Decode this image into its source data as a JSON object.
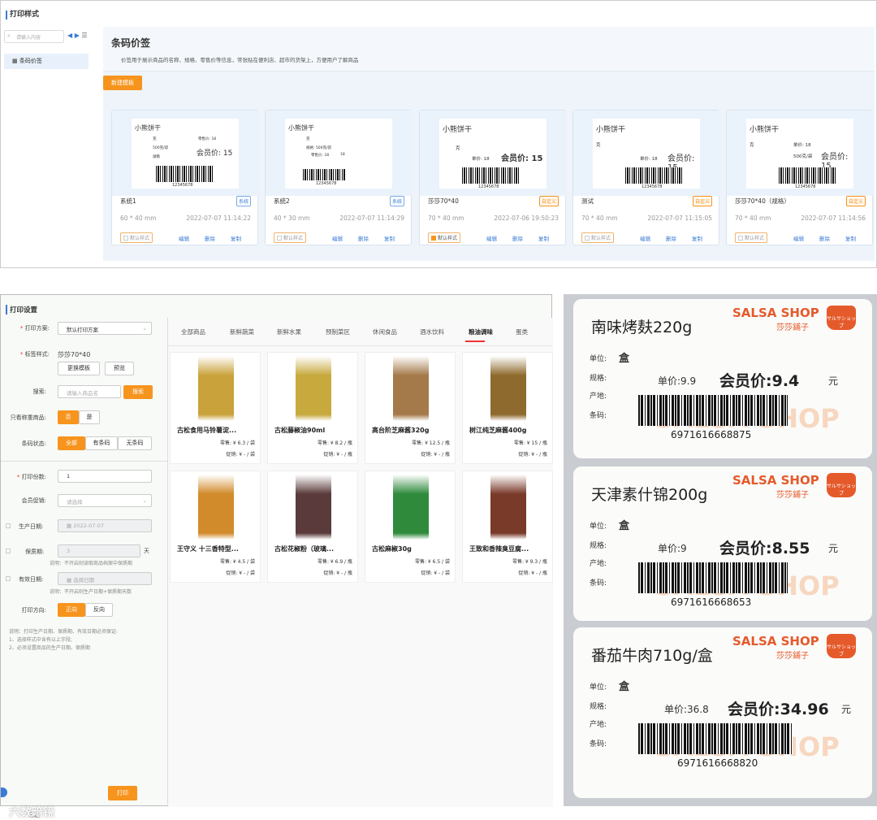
{
  "panel1": {
    "title": "打印样式",
    "search_placeholder": "请输入内容",
    "tree_item": "条码价签",
    "header_title": "条码价签",
    "header_desc": "价签用于展示商品的名称、规格、零售价等信息，常张贴在便利店、超市的货架上，方便用户了解商品",
    "new_button": "新建模板",
    "cards": [
      {
        "preview_name": "小熊饼干",
        "label": "系统1",
        "tag": "系统",
        "size": "60 * 40 mm",
        "date": "2022-07-07 11:14:22",
        "default": "默认样式",
        "default_on": false
      },
      {
        "preview_name": "小熊饼干",
        "label": "系统2",
        "tag": "系统",
        "size": "40 * 30 mm",
        "date": "2022-07-07 11:14:29",
        "default": "默认样式",
        "default_on": false
      },
      {
        "preview_name": "小熊饼干",
        "label": "莎莎70*40",
        "tag": "自定义",
        "size": "70 * 40 mm",
        "date": "2022-07-06 19:50:23",
        "default": "默认样式",
        "default_on": true
      },
      {
        "preview_name": "小熊饼干",
        "label": "测试",
        "tag": "自定义",
        "size": "70 * 40 mm",
        "date": "2022-07-07 11:15:05",
        "default": "默认样式",
        "default_on": false
      },
      {
        "preview_name": "小熊饼干",
        "label": "莎莎70*40（规格）",
        "tag": "自定义",
        "size": "70 * 40 mm",
        "date": "2022-07-07 11:14:56",
        "default": "默认样式",
        "default_on": false
      }
    ],
    "actions": {
      "edit": "编辑",
      "delete": "删除",
      "copy": "复制"
    },
    "preview": {
      "unit": "克",
      "spec": "500克/袋",
      "spec2": "规格: 500克/袋",
      "origin": "湖南",
      "retail": "零售价: 18",
      "unit_price": "单价: 18",
      "member1": "会员价: 15",
      "member_bold": "会员价: 15",
      "barcode": "12345678"
    }
  },
  "panel2": {
    "title": "打印设置",
    "plan_label": "打印方案:",
    "plan_value": "默认打印方案",
    "style_label": "标签样式:",
    "style_value": "莎莎70*40",
    "change_btn": "更换模板",
    "preview_btn": "预览",
    "search_label": "搜索:",
    "search_placeholder": "请输入商品名",
    "search_btn": "搜索",
    "weigh_label": "只看称重商品:",
    "weigh_no": "否",
    "weigh_yes": "是",
    "barcode_label": "条码状态:",
    "bc_all": "全部",
    "bc_has": "有条码",
    "bc_none": "无条码",
    "copies_label": "打印份数:",
    "copies_value": "1",
    "promo_label": "会员促销:",
    "promo_placeholder": "请选择",
    "prod_date_label": "生产日期:",
    "prod_date_value": "2022-07-07",
    "shelf_label": "保质期:",
    "shelf_value": "3",
    "shelf_unit": "天",
    "shelf_note": "说明：不开启则读取商品档案中保质期",
    "expire_label": "有效日期:",
    "expire_placeholder": "选择日期",
    "expire_note": "说明：不开启则生产日期+保质期天数",
    "dir_label": "打印方向:",
    "dir_forward": "正向",
    "dir_reverse": "反向",
    "note1": "说明：打印生产日期、保质期、有效日期必须保证:",
    "note2": "1、选择样式中含有以上字段;",
    "note3": "2、必须设置商品的生产日期、保质期",
    "selected": "已选",
    "print_btn": "打印",
    "watermark": "六数暗镜",
    "tabs": [
      "全部商品",
      "新鲜蔬菜",
      "新鲜水果",
      "预制菜区",
      "休闲食品",
      "酒水饮料",
      "粮油调味",
      "蛋类"
    ],
    "products": [
      {
        "name": "古松食用马铃薯淀...",
        "price": "零售: ¥ 6.3 / 袋",
        "promo": "促销: ¥ - / 袋",
        "color": "#c9a23b"
      },
      {
        "name": "古松藤椒油90ml",
        "price": "零售: ¥ 8.2 / 瓶",
        "promo": "促销: ¥ - / 瓶",
        "color": "#c7a93e"
      },
      {
        "name": "高台阶芝麻酱320g",
        "price": "零售: ¥ 12.5 / 瓶",
        "promo": "促销: ¥ - / 瓶",
        "color": "#a47a4a"
      },
      {
        "name": "树江纯芝麻酱400g",
        "price": "零售: ¥ 15 / 瓶",
        "promo": "促销: ¥ - / 瓶",
        "color": "#8e6a2e"
      },
      {
        "name": "王守义 十三香特型...",
        "price": "零售: ¥ 4.5 / 袋",
        "promo": "促销: ¥ - / 袋",
        "color": "#d18b2a"
      },
      {
        "name": "古松花椒粉（玻璃...",
        "price": "零售: ¥ 6.9 / 瓶",
        "promo": "促销: ¥ - / 瓶",
        "color": "#5a3a3a"
      },
      {
        "name": "古松麻椒30g",
        "price": "零售: ¥ 6.5 / 袋",
        "promo": "促销: ¥ - / 袋",
        "color": "#2f8a3c"
      },
      {
        "name": "王致和香辣臭豆腐...",
        "price": "零售: ¥ 9.3 / 瓶",
        "promo": "促销: ¥ - / 瓶",
        "color": "#7a3a2a"
      }
    ]
  },
  "photo": {
    "shop": "SALSA SHOP",
    "shop_sub": "莎莎鋪子",
    "logo": "サルサショップ",
    "unit_label": "单位:",
    "spec_label": "规格:",
    "origin_label": "产地:",
    "barcode_label": "条码:",
    "unit_val": "盒",
    "stickers": [
      {
        "name": "南味烤麸220g",
        "unit_price": "单价:9.9",
        "member": "会员价:9.4",
        "yuan": "元",
        "barcode": "6971616668875"
      },
      {
        "name": "天津素什锦200g",
        "unit_price": "单价:9",
        "member": "会员价:8.55",
        "yuan": "元",
        "barcode": "6971616668653"
      },
      {
        "name": "番茄牛肉710g/盒",
        "unit_price": "单价:36.8",
        "member": "会员价:34.96",
        "yuan": "元",
        "barcode": "6971616668820"
      }
    ]
  }
}
